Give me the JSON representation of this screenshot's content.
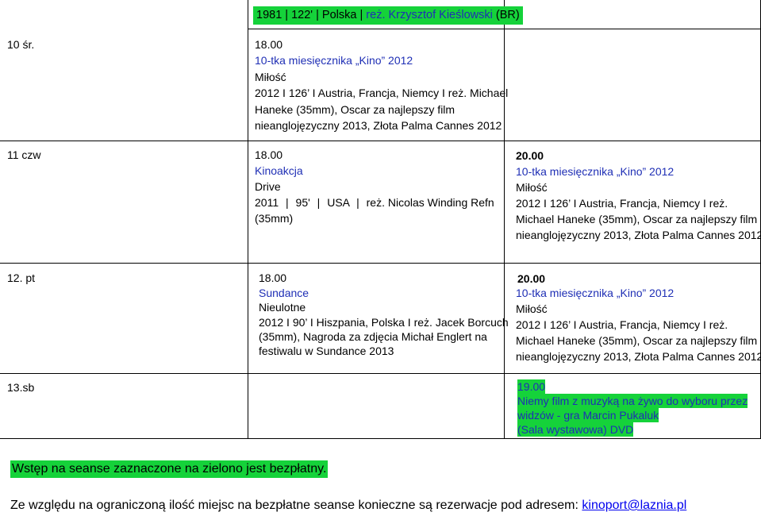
{
  "header_row": {
    "a": "1981",
    "sep1": "|",
    "b": "122'",
    "sep2": "|",
    "c": "Polska",
    "sep3": "|",
    "d": "reż. Krzysztof Kieślowski",
    "e": "(BR)"
  },
  "rows": {
    "r10": {
      "day": "10 śr.",
      "time": "18.00",
      "series": "10-tka miesięcznika „Kino” 2012",
      "title": "Miłość",
      "l1": "2012 I 126’ I Austria, Francja,  Niemcy I reż. Michael",
      "l2": "Haneke (35mm), Oscar za najlepszy film",
      "l3": "nieanglojęzyczny 2013, Złota Palma Cannes 2012"
    },
    "r11": {
      "day": "11 czw",
      "time": "18.00",
      "series": "Kinoakcja",
      "title": "Drive",
      "meta_a": "2011",
      "meta_b": "95'",
      "meta_c": "USA",
      "meta_d": "reż. Nicolas Winding Refn",
      "fmt": "(35mm)",
      "time2": "20.00",
      "series2": "10-tka miesięcznika „Kino” 2012",
      "title2": "Miłość",
      "m1": "2012 I 126’ I Austria, Francja,  Niemcy I reż.",
      "m2": "Michael Haneke (35mm), Oscar za najlepszy film",
      "m3": "nieanglojęzyczny 2013, Złota Palma Cannes 2012"
    },
    "r12": {
      "day": "12. pt",
      "time": "18.00",
      "series": "Sundance",
      "title": "Nieulotne",
      "l1": "2012 I 90’ I Hiszpania, Polska I reż. Jacek Borcuch",
      "l2": "(35mm), Nagroda za zdjęcia Michał Englert na",
      "l3": "festiwalu w Sundance 2013",
      "time2": "20.00",
      "series2": "10-tka miesięcznika „Kino” 2012",
      "title2": "Miłość",
      "m1": "2012 I 126’ I Austria, Francja,  Niemcy I reż.",
      "m2": "Michael Haneke (35mm), Oscar za najlepszy film",
      "m3": "nieanglojęzyczny 2013, Złota Palma Cannes 2012"
    },
    "r13": {
      "day": "13.sb",
      "time": "19.00",
      "e1": "Niemy film z muzyką na żywo do wyboru przez",
      "e2": "widzów - gra Marcin Pukaluk",
      "e3": "(Sala wystawowa) DVD"
    }
  },
  "notes": {
    "free": "Wstęp na seanse zaznaczone na zielono jest bezpłatny.",
    "reserve": "Ze względu na ograniczoną ilość miejsc na bezpłatne seanse konieczne są rezerwacje pod adresem:",
    "email": "kinoport@laznia.pl"
  },
  "colors": {
    "free_highlight": "#15d23a",
    "event_text": "#1f2fb5"
  }
}
